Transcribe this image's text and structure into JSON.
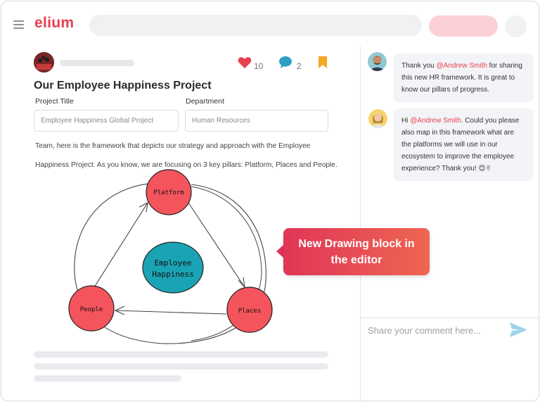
{
  "app": {
    "logo": "elium"
  },
  "post": {
    "title": "Our Employee Happiness Project",
    "likes": "10",
    "comments": "2",
    "fields": {
      "project_title_label": "Project Title",
      "project_title_value": "Employee Happiness Global Project",
      "department_label": "Department",
      "department_value": "Human Resources"
    },
    "body": "Team, here is the framework that depicts our strategy and approach with the Employee Happiness Project. As you know, we are focusing on 3 key pillars: Platform, Places and People."
  },
  "diagram": {
    "center_line1": "Employee",
    "center_line2": "Happiness",
    "node_platform": "Platform",
    "node_people": "People",
    "node_places": "Places",
    "colors": {
      "node_fill": "#f4545c",
      "center_fill": "#1aa3b4"
    }
  },
  "callout": {
    "line1": "New Drawing block in",
    "line2": "the editor"
  },
  "comments": [
    {
      "pre": "Thank you ",
      "mention": "@Andrew Smith",
      "post": " for sharing this new HR framework. It is great to know our pillars of progress."
    },
    {
      "pre": "Hi ",
      "mention": "@Andrew Smith.",
      "post": "  Could you please also map in this framework what are the platforms we will use in our ecosystem to improve the employee experience? Thank you! 😊✌"
    }
  ],
  "composer": {
    "placeholder": "Share your comment here..."
  },
  "colors": {
    "brand": "#e8404f",
    "accent_pill": "#fbd0d6",
    "heart": "#e8404f",
    "comment_icon": "#2d9fc4",
    "bookmark": "#f5a623",
    "send": "#9fd3e8"
  }
}
